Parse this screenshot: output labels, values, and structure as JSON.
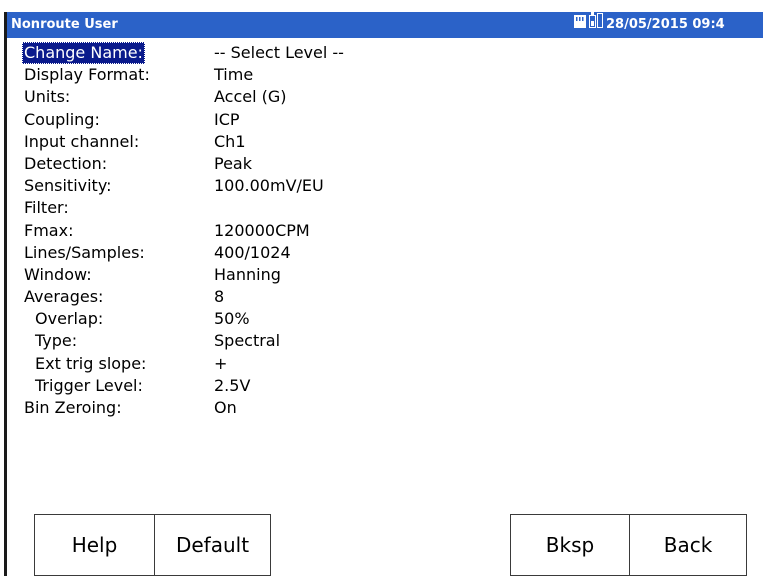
{
  "window": {
    "title": "Nonroute User",
    "datetime": "28/05/2015 09:4"
  },
  "settings": [
    {
      "label": "Change Name:",
      "value": "-- Select Level --",
      "indent": false,
      "selected": true
    },
    {
      "label": "Display Format:",
      "value": "Time",
      "indent": false,
      "selected": false
    },
    {
      "label": "Units:",
      "value": "Accel (G)",
      "indent": false,
      "selected": false
    },
    {
      "label": "Coupling:",
      "value": "ICP",
      "indent": false,
      "selected": false
    },
    {
      "label": "Input channel:",
      "value": "Ch1",
      "indent": false,
      "selected": false
    },
    {
      "label": "Detection:",
      "value": "Peak",
      "indent": false,
      "selected": false
    },
    {
      "label": "Sensitivity:",
      "value": "100.00mV/EU",
      "indent": false,
      "selected": false
    },
    {
      "label": "Filter:",
      "value": "",
      "indent": false,
      "selected": false
    },
    {
      "label": "Fmax:",
      "value": "120000CPM",
      "indent": false,
      "selected": false
    },
    {
      "label": "Lines/Samples:",
      "value": "400/1024",
      "indent": false,
      "selected": false
    },
    {
      "label": "Window:",
      "value": "Hanning",
      "indent": false,
      "selected": false
    },
    {
      "label": "Averages:",
      "value": "8",
      "indent": false,
      "selected": false
    },
    {
      "label": "Overlap:",
      "value": "50%",
      "indent": true,
      "selected": false
    },
    {
      "label": "Type:",
      "value": "Spectral",
      "indent": true,
      "selected": false
    },
    {
      "label": "Ext trig slope:",
      "value": "+",
      "indent": true,
      "selected": false
    },
    {
      "label": "Trigger Level:",
      "value": "2.5V",
      "indent": true,
      "selected": false
    },
    {
      "label": "Bin Zeroing:",
      "value": "On",
      "indent": false,
      "selected": false
    }
  ],
  "buttons": {
    "help": "Help",
    "default": "Default",
    "bksp": "Bksp",
    "back": "Back"
  },
  "icons": {
    "memory": "memory-card-icon",
    "battery": "battery-icon"
  },
  "colors": {
    "titlebar": "#2b62c8",
    "selection": "#0a1a8c"
  }
}
